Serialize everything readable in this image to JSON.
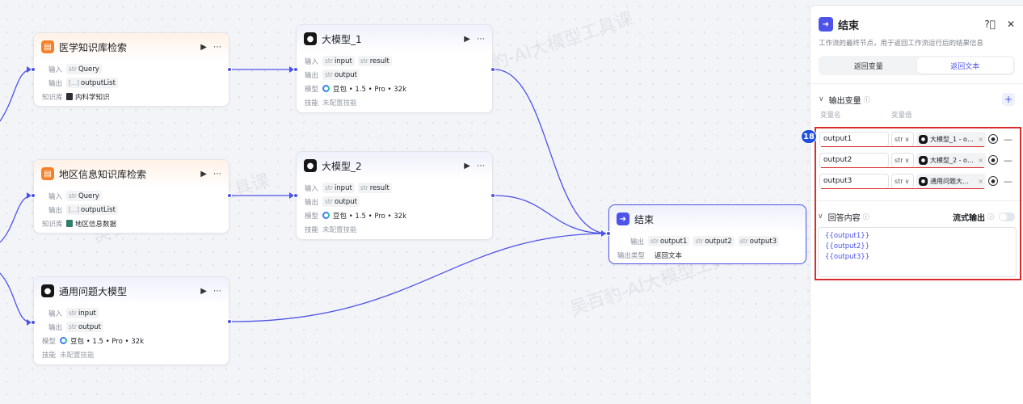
{
  "watermark": "吴百豹-AI大模型工具课",
  "canvas": {
    "labels": {
      "input": "输入",
      "output": "输出",
      "kb": "知识库",
      "model": "模型",
      "skill": "技能",
      "no_skill": "未配置技能",
      "output_type": "输出类型"
    },
    "nodes": {
      "med_kb": {
        "title": "医学知识库检索",
        "input_type": "str",
        "input": "Query",
        "output_type": "[...]",
        "output": "outputList",
        "kb_name": "内科学知识"
      },
      "region_kb": {
        "title": "地区信息知识库检索",
        "input_type": "str",
        "input": "Query",
        "output_type": "[...]",
        "output": "outputList",
        "kb_name": "地区信息数据"
      },
      "general_llm": {
        "title": "通用问题大模型",
        "input_type": "str",
        "input": "input",
        "output_type": "str",
        "output": "output",
        "model": "豆包 • 1.5 • Pro • 32k"
      },
      "llm1": {
        "title": "大模型_1",
        "input_type": "str",
        "input": "input",
        "input2_type": "str",
        "input2": "result",
        "output_type": "str",
        "output": "output",
        "model": "豆包 • 1.5 • Pro • 32k"
      },
      "llm2": {
        "title": "大模型_2",
        "input_type": "str",
        "input": "input",
        "input2_type": "str",
        "input2": "result",
        "output_type": "str",
        "output": "output",
        "model": "豆包 • 1.5 • Pro • 32k"
      },
      "end": {
        "title": "结束",
        "outputs": [
          {
            "type": "str",
            "name": "output1"
          },
          {
            "type": "str",
            "name": "output2"
          },
          {
            "type": "str",
            "name": "output3"
          }
        ],
        "output_type_value": "返回文本"
      }
    }
  },
  "panel": {
    "title": "结束",
    "description": "工作流的最终节点，用于返回工作流运行后的结果信息",
    "tabs": [
      "返回变量",
      "返回文本"
    ],
    "active_tab": 1,
    "output_vars_title": "输出变量",
    "col_name": "变量名",
    "col_value": "变量值",
    "step_badge": "18",
    "vars": [
      {
        "name": "output1",
        "type": "str",
        "ref": "大模型_1 - o…"
      },
      {
        "name": "output2",
        "type": "str",
        "ref": "大模型_2 - o…"
      },
      {
        "name": "output3",
        "type": "str",
        "ref": "通用问题大…"
      }
    ],
    "answer_title": "回答内容",
    "stream_label": "流式输出",
    "stream_on": false,
    "answer_lines": [
      "{{output1}}",
      "{{output2}}",
      "{{output3}}"
    ]
  },
  "colors": {
    "accent": "#4d53e8",
    "kb_orange": "#f5822a",
    "highlight_red": "#d92d2d",
    "badge_blue": "#1f4fe0"
  }
}
